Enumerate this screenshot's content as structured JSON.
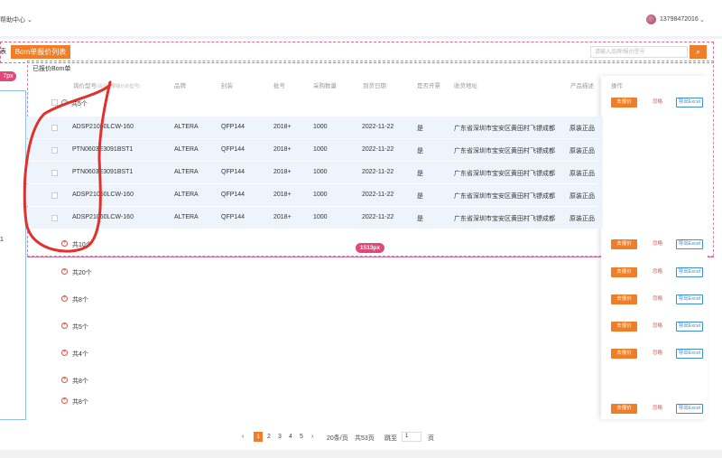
{
  "header": {
    "help_center": "帮助中心",
    "phone": "13798472016"
  },
  "tabs": {
    "left_cut": "表",
    "active": "Bom单报价列表"
  },
  "search": {
    "placeholder": "请输入品牌/报价型号",
    "icon": "search-icon"
  },
  "annotations": {
    "left_badge": "7px",
    "width_badge": "1513px"
  },
  "section_title": "已报价Bom单",
  "columns": {
    "model": "询价型号",
    "model_hint": "(请勾选要报价的型号)",
    "brand": "品牌",
    "package": "封装",
    "batch": "批号",
    "qty": "采购数量",
    "date": "到货日期",
    "invoice": "是否开票",
    "address": "收货地址",
    "desc": "产品描述",
    "ops": "操作"
  },
  "expanded_group": {
    "count": "共5个",
    "rows": [
      {
        "model": "ADSP21060LCW-160",
        "brand": "ALTERA",
        "package": "QFP144",
        "batch": "2018+",
        "qty": "1000",
        "date": "2022-11-22",
        "invoice": "是",
        "address": "广东省深圳市宝安区黄田村飞镖成都",
        "desc": "原装正品"
      },
      {
        "model": "PTN0603E3091BST1",
        "brand": "ALTERA",
        "package": "QFP144",
        "batch": "2018+",
        "qty": "1000",
        "date": "2022-11-22",
        "invoice": "是",
        "address": "广东省深圳市宝安区黄田村飞镖成都",
        "desc": "原装正品"
      },
      {
        "model": "PTN0603E3091BST1",
        "brand": "ALTERA",
        "package": "QFP144",
        "batch": "2018+",
        "qty": "1000",
        "date": "2022-11-22",
        "invoice": "是",
        "address": "广东省深圳市宝安区黄田村飞镖成都",
        "desc": "原装正品"
      },
      {
        "model": "ADSP21060LCW-160",
        "brand": "ALTERA",
        "package": "QFP144",
        "batch": "2018+",
        "qty": "1000",
        "date": "2022-11-22",
        "invoice": "是",
        "address": "广东省深圳市宝安区黄田村飞镖成都",
        "desc": "原装正品"
      },
      {
        "model": "ADSP21060LCW-160",
        "brand": "ALTERA",
        "package": "QFP144",
        "batch": "2018+",
        "qty": "1000",
        "date": "2022-11-22",
        "invoice": "是",
        "address": "广东省深圳市宝安区黄田村飞镖成都",
        "desc": "原装正品"
      }
    ]
  },
  "collapsed_groups": [
    "共10个",
    "共20个",
    "共8个",
    "共5个",
    "共4个",
    "共8个",
    "共8个"
  ],
  "actions": {
    "quote": "去报价",
    "ignore": "忽略",
    "export": "导出Excel"
  },
  "pagination": {
    "prev": "‹",
    "pages": [
      "1",
      "2",
      "3",
      "4",
      "5"
    ],
    "active_page": "1",
    "next": "›",
    "per_page": "20条/页",
    "total": "共53页",
    "jump_label": "跳至",
    "jump_value": "1",
    "page_unit": "页"
  },
  "colors": {
    "accent": "#f07d27",
    "blue": "#3a8fd8",
    "annotation": "#e04a7a"
  }
}
